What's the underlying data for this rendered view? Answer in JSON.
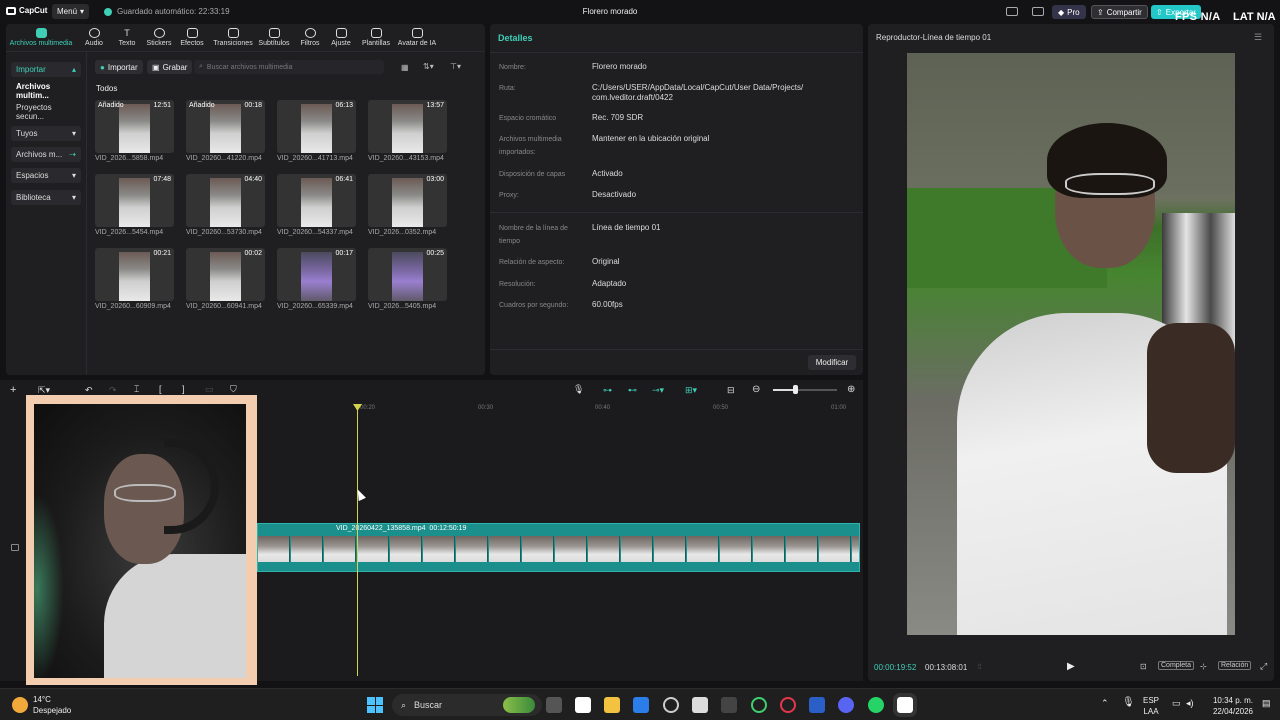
{
  "titlebar": {
    "app_name": "CapCut",
    "menu_label": "Menú",
    "autosave_text": "Guardado automático: 22:33:19",
    "project_name": "Florero morado",
    "pro_label": "Pro",
    "share_label": "Compartir",
    "export_label": "Exportar"
  },
  "overlay": {
    "fps_text": "FPS N/A",
    "lat_text": "LAT N/A"
  },
  "toolbar": {
    "tools": [
      {
        "label": "Archivos multimedia",
        "icon": "media-icon"
      },
      {
        "label": "Audio",
        "icon": "audio-icon"
      },
      {
        "label": "Texto",
        "icon": "text-icon"
      },
      {
        "label": "Stickers",
        "icon": "sticker-icon"
      },
      {
        "label": "Efectos",
        "icon": "effects-icon"
      },
      {
        "label": "Transiciones",
        "icon": "transition-icon"
      },
      {
        "label": "Subtítulos",
        "icon": "subtitle-icon"
      },
      {
        "label": "Filtros",
        "icon": "filter-icon"
      },
      {
        "label": "Ajuste",
        "icon": "adjust-icon"
      },
      {
        "label": "Plantillas",
        "icon": "template-icon"
      },
      {
        "label": "Avatar de IA",
        "icon": "avatar-icon"
      }
    ]
  },
  "sidebar": {
    "items": [
      {
        "label": "Importar"
      },
      {
        "label": "Archivos multim..."
      },
      {
        "label": "Proyectos secun..."
      },
      {
        "label": "Tuyos"
      },
      {
        "label": "Archivos m..."
      },
      {
        "label": "Espacios"
      },
      {
        "label": "Biblioteca"
      }
    ]
  },
  "media": {
    "import_label": "Importar",
    "record_label": "Grabar",
    "search_placeholder": "Buscar archivos multimedia",
    "section_label": "Todos",
    "items": [
      {
        "name": "VID_2026...5858.mp4",
        "duration": "12:51",
        "badge": "Añadido"
      },
      {
        "name": "VID_20260...41220.mp4",
        "duration": "00:18",
        "badge": "Añadido"
      },
      {
        "name": "VID_20260...41713.mp4",
        "duration": "06:13",
        "badge": ""
      },
      {
        "name": "VID_20260...43153.mp4",
        "duration": "13:57",
        "badge": ""
      },
      {
        "name": "VID_2026...5454.mp4",
        "duration": "07:48",
        "badge": ""
      },
      {
        "name": "VID_20260...53730.mp4",
        "duration": "04:40",
        "badge": ""
      },
      {
        "name": "VID_20260...54337.mp4",
        "duration": "06:41",
        "badge": ""
      },
      {
        "name": "VID_2026...0352.mp4",
        "duration": "03:00",
        "badge": ""
      },
      {
        "name": "VID_20260...60909.mp4",
        "duration": "00:21",
        "badge": ""
      },
      {
        "name": "VID_20260...60941.mp4",
        "duration": "00:02",
        "badge": ""
      },
      {
        "name": "VID_20260...65339.mp4",
        "duration": "00:17",
        "badge": ""
      },
      {
        "name": "VID_2026...5405.mp4",
        "duration": "00:25",
        "badge": ""
      }
    ]
  },
  "details": {
    "title": "Detalles",
    "rows": [
      {
        "label": "Nombre:",
        "value": "Florero morado"
      },
      {
        "label": "Ruta:",
        "value": "C:/Users/USER/AppData/Local/CapCut/User Data/Projects/ com.lveditor.draft/0422"
      },
      {
        "label": "Espacio cromático",
        "value": "Rec. 709 SDR"
      },
      {
        "label": "Archivos multimedia importados:",
        "value": "Mantener en la ubicación original"
      },
      {
        "label": "Disposición de capas",
        "value": "Activado"
      },
      {
        "label": "Proxy:",
        "value": "Desactivado"
      },
      {
        "label": "Nombre de la línea de tiempo",
        "value": "Línea de tiempo 01"
      },
      {
        "label": "Relación de aspecto:",
        "value": "Original"
      },
      {
        "label": "Resolución:",
        "value": "Adaptado"
      },
      {
        "label": "Cuadros por segundo:",
        "value": "60.00fps"
      }
    ],
    "modify_label": "Modificar"
  },
  "player": {
    "title": "Reproductor-Línea de tiempo 01",
    "current_time": "00:00:19:52",
    "total_time": "00:13:08:01",
    "full_label": "Completa",
    "ratio_label": "Relación"
  },
  "timeline": {
    "ticks": [
      "00:20",
      "00:30",
      "00:40",
      "00:50",
      "01:00"
    ],
    "clip_name": "VID_20260422_135858.mp4",
    "clip_duration": "00:12:50:19"
  },
  "taskbar": {
    "temperature": "14°C",
    "weather": "Despejado",
    "search_label": "Buscar",
    "lang": "ESP",
    "layout": "LAA",
    "time": "10:34 p. m.",
    "date": "22/04/2026"
  },
  "colors": {
    "accent": "#3fcfb7",
    "playhead": "#d4d44c",
    "clip": "#1a8f8c"
  }
}
